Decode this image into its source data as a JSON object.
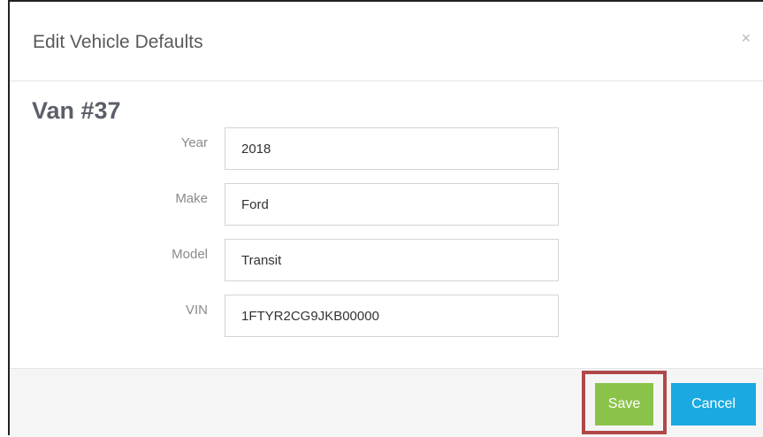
{
  "dialog": {
    "title": "Edit Vehicle Defaults",
    "close_glyph": "×",
    "vehicle_name": "Van #37"
  },
  "fields": {
    "year": {
      "label": "Year",
      "value": "2018"
    },
    "make": {
      "label": "Make",
      "value": "Ford"
    },
    "model": {
      "label": "Model",
      "value": "Transit"
    },
    "vin": {
      "label": "VIN",
      "value": "1FTYR2CG9JKB00000"
    }
  },
  "footer": {
    "save_label": "Save",
    "cancel_label": "Cancel"
  },
  "colors": {
    "save_button": "#8bc34a",
    "cancel_button": "#1ba9e1",
    "highlight_border": "#b04848"
  },
  "icons": {
    "close": "close-icon"
  }
}
